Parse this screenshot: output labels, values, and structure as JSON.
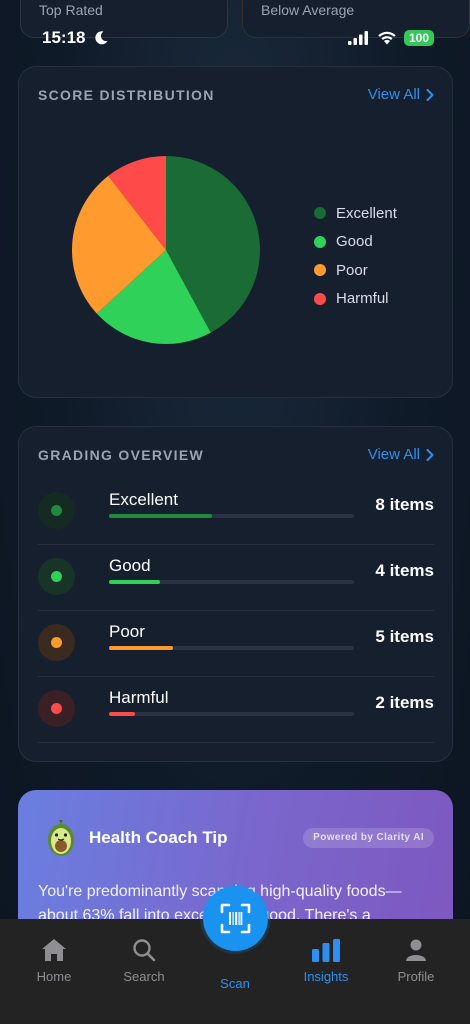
{
  "top_cards": {
    "left_label": "Top Rated",
    "right_label": "Below Average"
  },
  "status_bar": {
    "time": "15:18",
    "battery": "100"
  },
  "score_distribution": {
    "title": "SCORE DISTRIBUTION",
    "view_all": "View All",
    "legend": [
      {
        "label": "Excellent",
        "color": "#1a6b34"
      },
      {
        "label": "Good",
        "color": "#2fd158"
      },
      {
        "label": "Poor",
        "color": "#ff9a2e"
      },
      {
        "label": "Harmful",
        "color": "#ff4a4a"
      }
    ],
    "slices": [
      {
        "label": "Excellent",
        "value": 8,
        "color": "#1a6b34"
      },
      {
        "label": "Good",
        "value": 4,
        "color": "#2fd158"
      },
      {
        "label": "Poor",
        "value": 5,
        "color": "#ff9a2e"
      },
      {
        "label": "Harmful",
        "value": 2,
        "color": "#ff4a4a"
      }
    ]
  },
  "grading_overview": {
    "title": "GRADING OVERVIEW",
    "view_all": "View All",
    "rows": [
      {
        "label": "Excellent",
        "count": "8 items",
        "fraction": 0.42,
        "color": "#1e8a3e",
        "circle": "#142a22",
        "dot": "#1e8a3e"
      },
      {
        "label": "Good",
        "count": "4 items",
        "fraction": 0.21,
        "color": "#2fd158",
        "circle": "#183426",
        "dot": "#2fd158"
      },
      {
        "label": "Poor",
        "count": "5 items",
        "fraction": 0.26,
        "color": "#ff9a2e",
        "circle": "#3a2b1e",
        "dot": "#ff9a2e"
      },
      {
        "label": "Harmful",
        "count": "2 items",
        "fraction": 0.105,
        "color": "#ff4a4a",
        "circle": "#3a1f24",
        "dot": "#ff4a4a"
      }
    ]
  },
  "coach_tip": {
    "title": "Health Coach Tip",
    "badge": "Powered by Clarity AI",
    "text": "You're predominantly scanning high-quality foods—about 63% fall into excellent or good. There's a"
  },
  "tab_bar": {
    "home": "Home",
    "search": "Search",
    "scan": "Scan",
    "insights": "Insights",
    "profile": "Profile"
  }
}
